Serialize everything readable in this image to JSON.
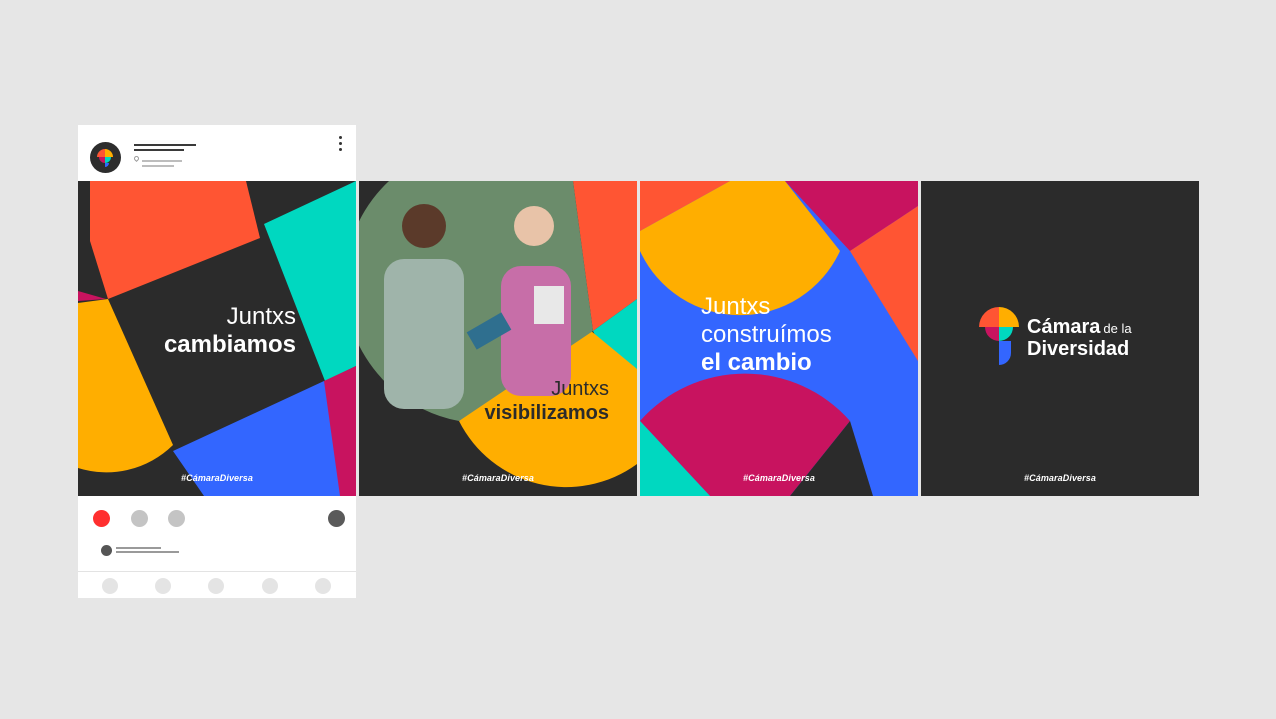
{
  "background_color": "#e6e6e6",
  "brand_colors": {
    "orange_red": "#ff5533",
    "teal": "#00d8c0",
    "yellow": "#ffae00",
    "blue": "#3366ff",
    "magenta": "#c8135f",
    "dark": "#2b2b2b"
  },
  "post_header": {
    "avatar_icon": "brand-logo-icon",
    "more_icon": "kebab-menu-icon",
    "location_icon": "location-pin-icon"
  },
  "cards": [
    {
      "line1": "Juntxs",
      "line2": "cambiamos",
      "hashtag": "#CámaraDiversa"
    },
    {
      "line1": "Juntxs",
      "line2": "visibilizamos",
      "hashtag": "#CámaraDiversa"
    },
    {
      "line1": "Juntxs",
      "line2": "construímos",
      "line3": "el cambio",
      "hashtag": "#CámaraDiversa"
    },
    {
      "logo_word1": "Cámara",
      "logo_word2": "de la",
      "logo_word3": "Diversidad",
      "hashtag": "#CámaraDiversa"
    }
  ],
  "carousel": {
    "total": 3,
    "active": 1
  }
}
